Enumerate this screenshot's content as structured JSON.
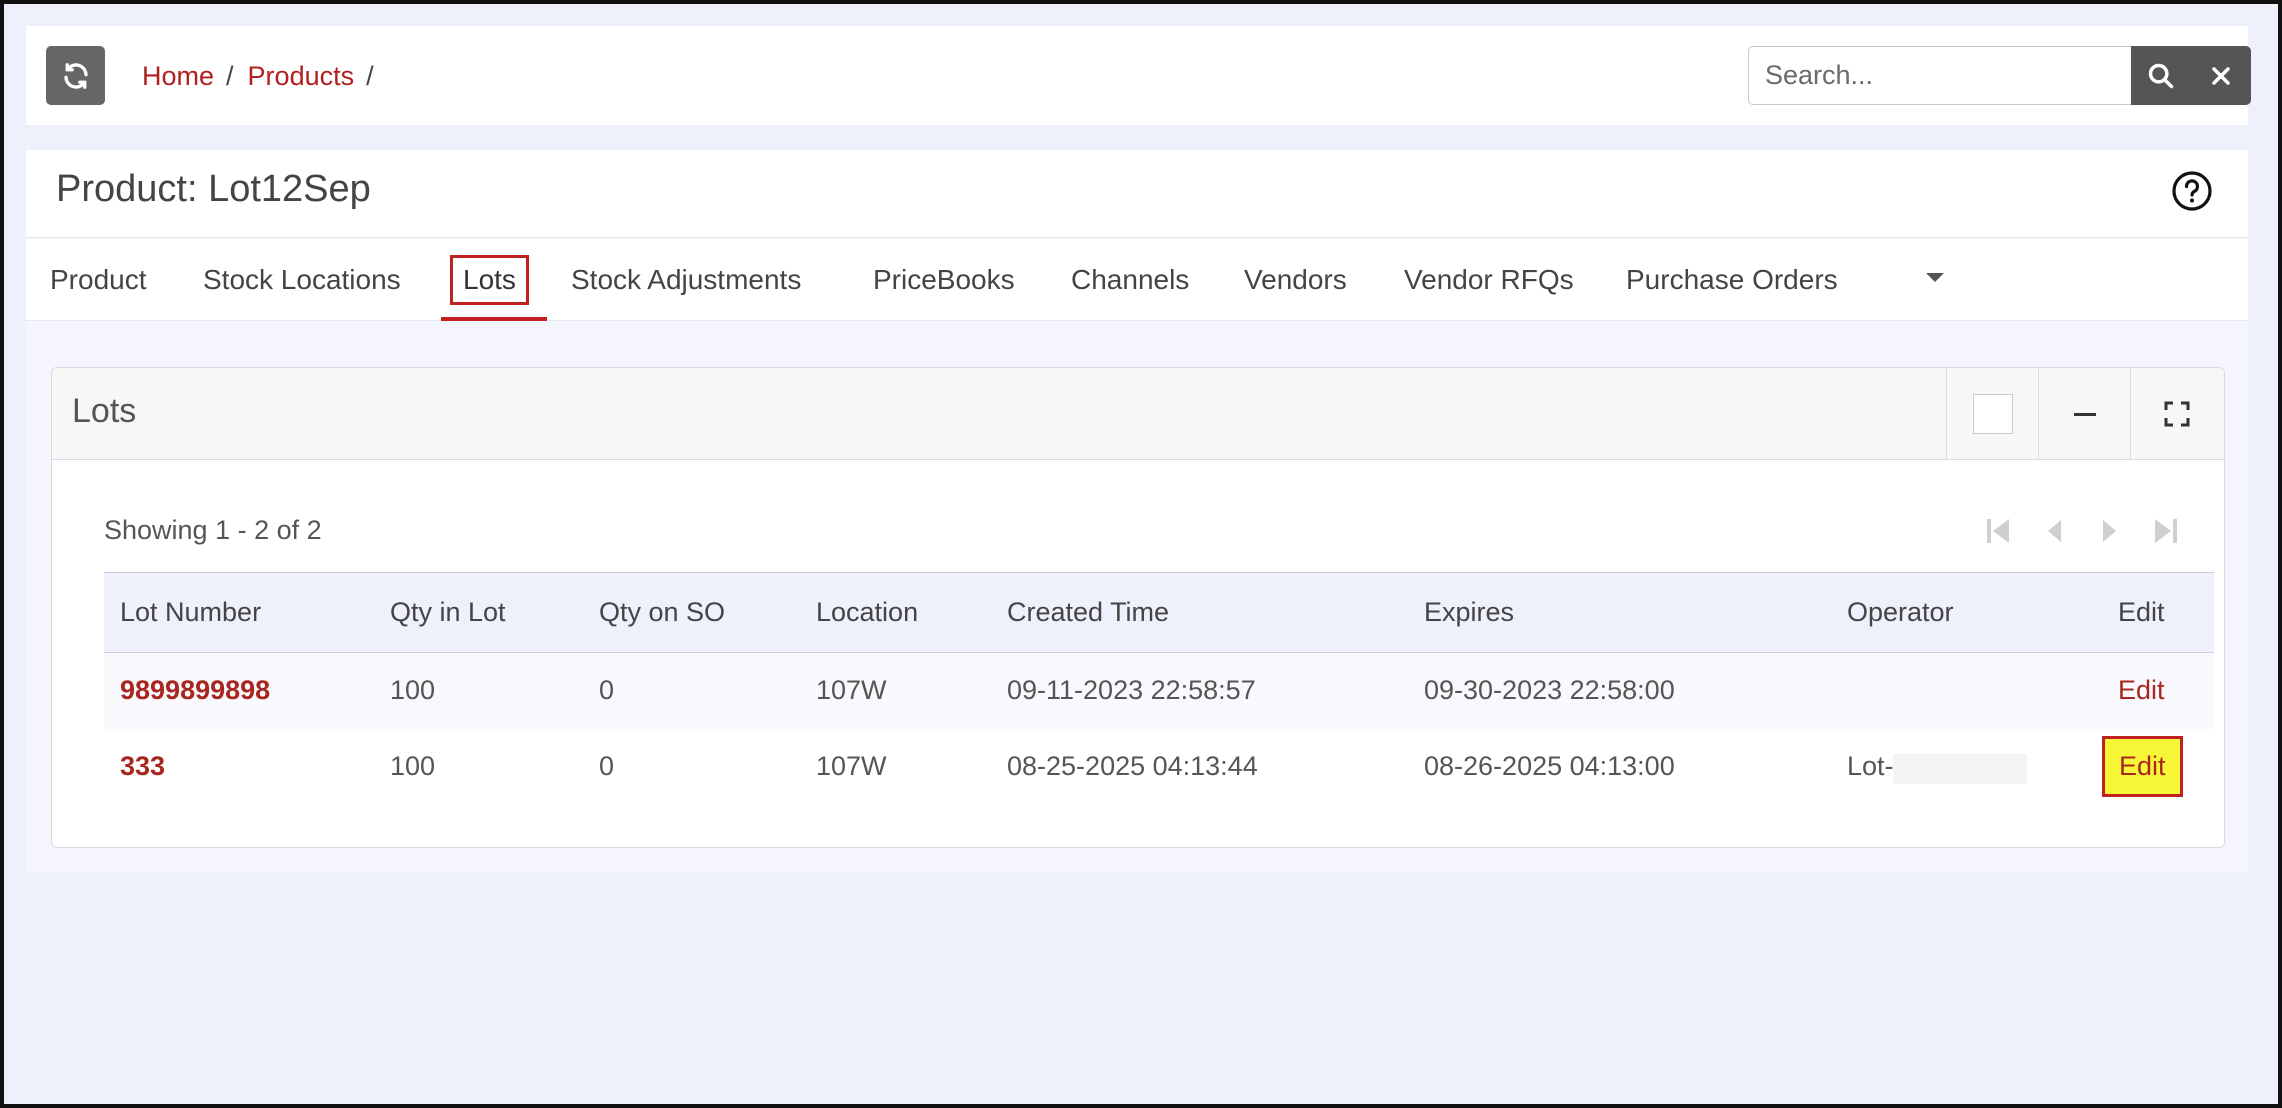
{
  "breadcrumb": {
    "items": [
      "Home",
      "Products"
    ]
  },
  "search": {
    "placeholder": "Search..."
  },
  "page": {
    "title": "Product: Lot12Sep"
  },
  "tabs": [
    {
      "label": "Product"
    },
    {
      "label": "Stock Locations"
    },
    {
      "label": "Lots",
      "active": true
    },
    {
      "label": "Stock Adjustments"
    },
    {
      "label": "PriceBooks"
    },
    {
      "label": "Channels"
    },
    {
      "label": "Vendors"
    },
    {
      "label": "Vendor RFQs"
    },
    {
      "label": "Purchase Orders"
    }
  ],
  "card": {
    "title": "Lots",
    "showing": "Showing 1 - 2 of 2"
  },
  "table": {
    "headers": [
      "Lot Number",
      "Qty in Lot",
      "Qty on SO",
      "Location",
      "Created Time",
      "Expires",
      "Operator",
      "Edit"
    ],
    "rows": [
      {
        "lot": "9899899898",
        "qty": "100",
        "qty_so": "0",
        "location": "107W",
        "created": "09-11-2023 22:58:57",
        "expires": "09-30-2023 22:58:00",
        "operator": "",
        "edit": "Edit"
      },
      {
        "lot": "333",
        "qty": "100",
        "qty_so": "0",
        "location": "107W",
        "created": "08-25-2025 04:13:44",
        "expires": "08-26-2025 04:13:00",
        "operator": "Lot-",
        "edit": "Edit"
      }
    ]
  },
  "colors": {
    "accent": "#c0221f",
    "link": "#a8261f",
    "highlight": "#f7f738"
  }
}
